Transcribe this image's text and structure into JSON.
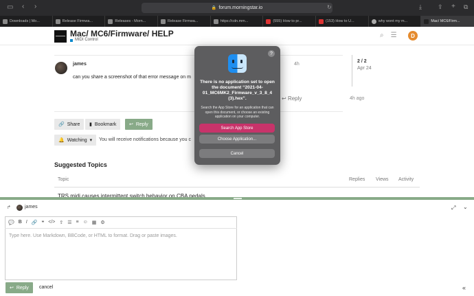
{
  "browser": {
    "url": "forum.morningstar.io",
    "tabs": [
      {
        "label": "Downloads | Mo..."
      },
      {
        "label": "Release Firmwa..."
      },
      {
        "label": "Releases - Morn..."
      },
      {
        "label": "Release Firmwa..."
      },
      {
        "label": "https://cdn.mm..."
      },
      {
        "label": "(555) How to pr..."
      },
      {
        "label": "(153) How to U..."
      },
      {
        "label": "why wont my m..."
      },
      {
        "label": "Mac/ MC6/Firm..."
      }
    ]
  },
  "header": {
    "title": "Mac/ MC6/Firmware/ HELP",
    "category": "MIDI Control",
    "user_initial": "D",
    "category_color": "#0088cc",
    "avatar_color": "#e58b2e"
  },
  "post": {
    "username": "james",
    "age": "4h",
    "body": "can you share a screenshot of that error message on m",
    "reply_label": "Reply",
    "reply_age": "4h ago"
  },
  "timeline": {
    "count": "2 / 2",
    "date": "Apr 24"
  },
  "actions": {
    "share": "Share",
    "bookmark": "Bookmark",
    "reply": "Reply",
    "watching": "Watching",
    "notify_text": "You will receive notifications because you c"
  },
  "suggested": {
    "heading": "Suggested Topics",
    "columns": [
      "Topic",
      "Replies",
      "Views",
      "Activity"
    ],
    "first_topic": "TRS midi causes intermittent switch behavior on CBA pedals"
  },
  "dialog": {
    "title": "There is no application set to open the document “2021-04-01_MC6MK2_Firmware_v_3_8_4 (3).hex”.",
    "message": "Search the App Store for an application that can open this document, or choose an existing application on your computer.",
    "search_button": "Search App Store",
    "choose_button": "Choose Application...",
    "cancel_button": "Cancel",
    "help": "?",
    "accent_color": "#c8336a"
  },
  "composer": {
    "reply_to": "james",
    "placeholder": "Type here. Use Markdown, BBCode, or HTML to format. Drag or paste images.",
    "reply_button": "Reply",
    "cancel": "cancel",
    "accent_color": "#88aa88"
  }
}
